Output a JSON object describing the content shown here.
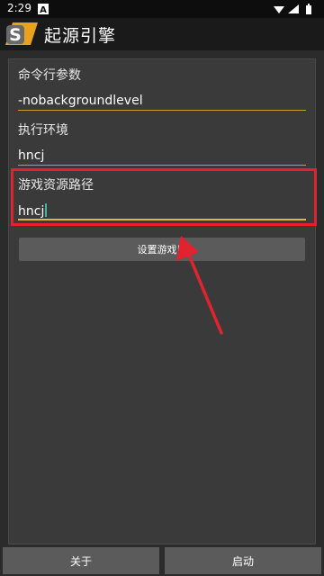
{
  "status_bar": {
    "time": "2:29",
    "icons": [
      "warning-icon",
      "wifi-icon",
      "signal-icon",
      "battery-icon"
    ]
  },
  "app_bar": {
    "title": "起源引擎",
    "logo_letter": "S"
  },
  "form": {
    "command_line": {
      "label": "命令行参数",
      "value": "-nobackgroundlevel"
    },
    "exec_env": {
      "label": "执行环境",
      "value": "hncj"
    },
    "game_path": {
      "label": "游戏资源路径",
      "value": "hncj"
    },
    "set_button": "设置游戏目"
  },
  "bottom": {
    "about_label": "关于",
    "start_label": "启动"
  },
  "colors": {
    "accent_underline": "#c4a22a",
    "highlight": "#e3222f",
    "button": "#5b5b5b",
    "panel": "#3a3a3a",
    "cursor": "#41b2a8"
  }
}
